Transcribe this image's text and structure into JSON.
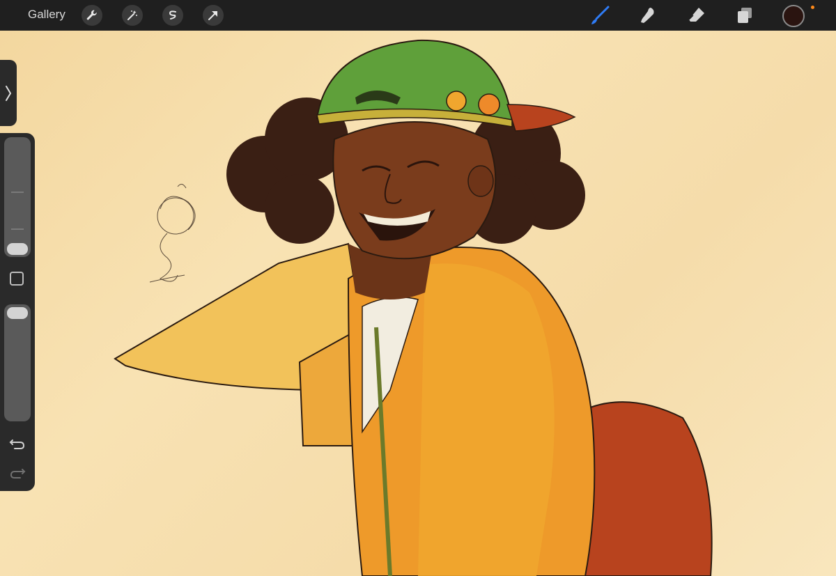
{
  "topbar": {
    "gallery_label": "Gallery",
    "left_tools": [
      "wrench-icon",
      "magic-wand-icon",
      "selection-icon",
      "transform-arrow-icon"
    ],
    "right_tools": [
      "brush-icon",
      "smudge-icon",
      "eraser-icon",
      "layers-icon"
    ],
    "active_tool": "brush-icon",
    "current_color": "#2a1410",
    "accent_color": "#2f7cf6"
  },
  "sidebar": {
    "brush_size_level": 0.08,
    "opacity_level": 0.92,
    "controls": [
      "modify-button",
      "undo-icon",
      "redo-icon"
    ]
  },
  "canvas": {
    "background_color": "#f6deaa"
  }
}
